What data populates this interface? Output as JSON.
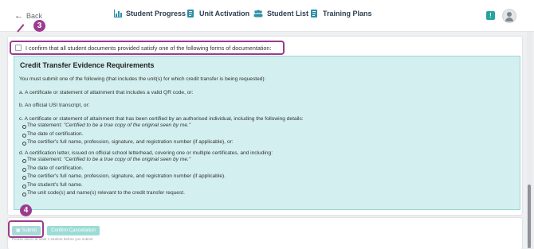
{
  "header": {
    "back_label": "Back",
    "nav": [
      {
        "label": "Student Progress",
        "icon": "bar-chart-icon"
      },
      {
        "label": "Unit Activation",
        "icon": "document-icon"
      },
      {
        "label": "Student List",
        "icon": "people-icon"
      },
      {
        "label": "Training Plans",
        "icon": "document-icon"
      }
    ],
    "chat_icon": "chat-icon",
    "avatar_icon": "user-avatar-icon"
  },
  "annotations": {
    "step3": "3",
    "step4": "4",
    "color": "#9b3b8e"
  },
  "confirm": {
    "label": "I confirm that all student documents provided satisfy one of the following forms of documentation:"
  },
  "evidence": {
    "title": "Credit Transfer Evidence Requirements",
    "intro": "You must submit one of the following (that includes the unit(s) for which credit transfer is being requested):",
    "item_a": "a. A certificate or statement of attainment that includes a valid QR code, or:",
    "item_b": "b. An official USI transcript, or:",
    "item_c": "c. A certificate or statement of attainment that has been certified by an authorised individual, including the following details:",
    "item_c_bullets": {
      "b1_prefix": "The statement: ",
      "b1_quote": "\"Certified to be a true copy of the original seen by me.\"",
      "b2": "The date of certification.",
      "b3": "The certifier's full name, profession, signature, and registration number (if applicable), or:"
    },
    "item_d": "d. A certification letter, issued on official school letterhead, covering one or multiple certificates, and including:",
    "item_d_bullets": {
      "b1_prefix": "The statement: ",
      "b1_quote": "\"Certified to be a true copy of the original seen by me.\"",
      "b2": "The date of certification.",
      "b3": "The certifier's full name, profession, signature, and registration number (if applicable).",
      "b4": "The student's full name.",
      "b5": "The unit code(s) and name(s) relevant to the credit transfer request."
    },
    "bg_color": "#d3efef"
  },
  "footer": {
    "submit_label": "Submit",
    "cancel_label": "Confirm Cancellation",
    "hint": "Please select at least 1 student before you submit",
    "accent": "#25a4a0"
  }
}
